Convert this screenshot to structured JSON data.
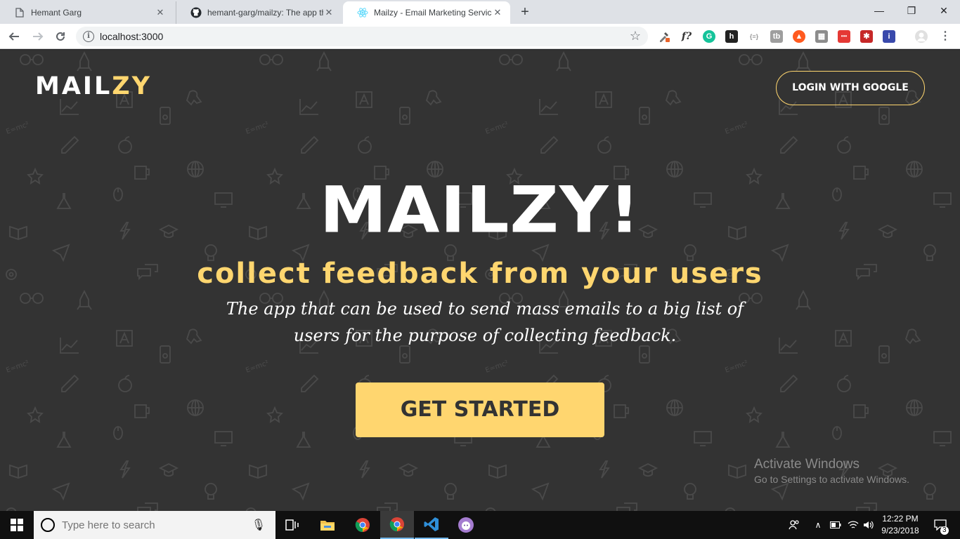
{
  "browser": {
    "tabs": [
      {
        "title": "Hemant Garg",
        "close": "✕"
      },
      {
        "title": "hemant-garg/mailzy: The app tha",
        "close": "✕"
      },
      {
        "title": "Mailzy - Email Marketing Service",
        "close": "✕"
      }
    ],
    "new_tab": "+",
    "window_controls": {
      "minimize": "—",
      "restore": "❐",
      "close": "✕"
    },
    "address": "localhost:3000",
    "extensions": [
      {
        "label": "f?",
        "color": "#ffffff",
        "text_color": "#333333"
      },
      {
        "label": "G",
        "color": "#15c39a",
        "text_color": "#ffffff"
      },
      {
        "label": "h",
        "color": "#222222",
        "text_color": "#ffffff"
      },
      {
        "label": "{≡}",
        "color": "#ffffff",
        "text_color": "#999999"
      },
      {
        "label": "tb",
        "color": "#9e9e9e",
        "text_color": "#ffffff"
      },
      {
        "label": "▲",
        "color": "#ff5a1f",
        "text_color": "#ffffff"
      },
      {
        "label": "▦",
        "color": "#8c8c8c",
        "text_color": "#ffffff"
      },
      {
        "label": "•••",
        "color": "#e53935",
        "text_color": "#ffffff"
      },
      {
        "label": "✱",
        "color": "#c62828",
        "text_color": "#ffffff"
      },
      {
        "label": "i",
        "color": "#3949ab",
        "text_color": "#ffffff"
      }
    ]
  },
  "page": {
    "logo_main": "MAIL",
    "logo_highlight": "ZY",
    "login_label": "LOGIN WITH GOOGLE",
    "hero_title": "MAILZY!",
    "hero_subtitle": "collect feedback from your users",
    "hero_description": "The app that can be used to send mass emails to a big list of users for the purpose of collecting feedback.",
    "cta_label": "GET STARTED",
    "colors": {
      "background": "#333333",
      "accent": "#ffd66f",
      "text": "#ffffff"
    }
  },
  "watermark": {
    "line1": "Activate Windows",
    "line2": "Go to Settings to activate Windows."
  },
  "taskbar": {
    "search_placeholder": "Type here to search",
    "time": "12:22 PM",
    "date": "9/23/2018",
    "notifications": "3"
  }
}
